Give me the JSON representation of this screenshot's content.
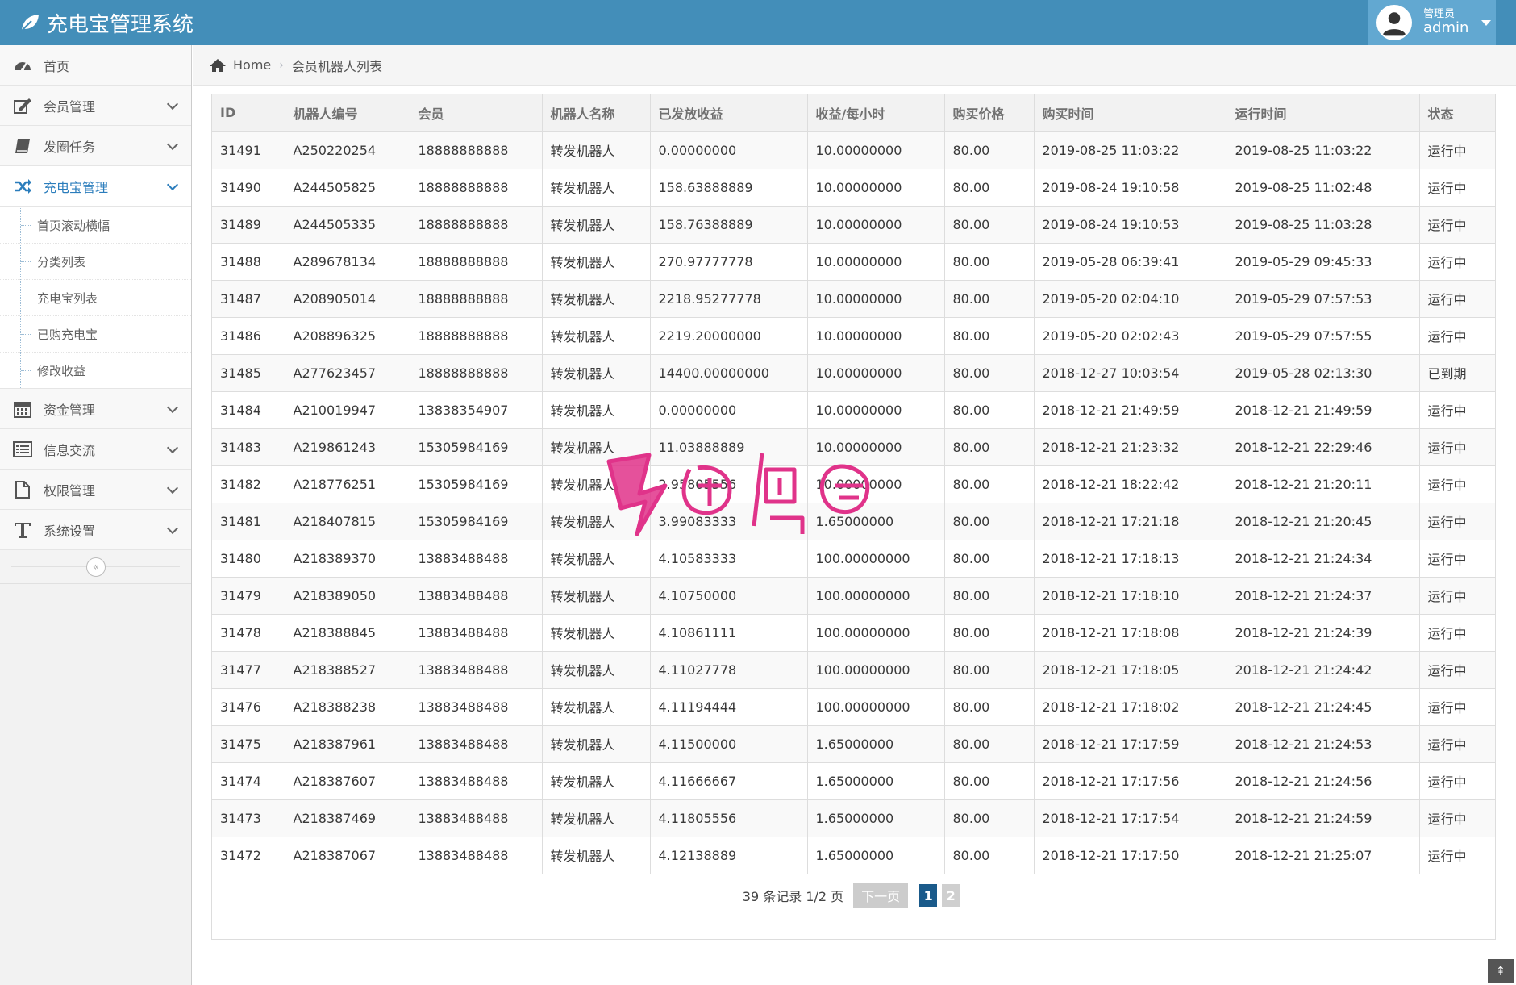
{
  "app": {
    "title": "充电宝管理系统"
  },
  "user": {
    "role": "管理员",
    "name": "admin"
  },
  "sidebar": {
    "items": [
      {
        "label": "首页",
        "icon": "dashboard-icon",
        "expandable": false
      },
      {
        "label": "会员管理",
        "icon": "edit-icon",
        "expandable": true
      },
      {
        "label": "发圈任务",
        "icon": "book-icon",
        "expandable": true
      },
      {
        "label": "充电宝管理",
        "icon": "shuffle-icon",
        "expandable": true,
        "active": true
      },
      {
        "label": "资金管理",
        "icon": "calendar-icon",
        "expandable": true
      },
      {
        "label": "信息交流",
        "icon": "list-alt-icon",
        "expandable": true
      },
      {
        "label": "权限管理",
        "icon": "file-icon",
        "expandable": true
      },
      {
        "label": "系统设置",
        "icon": "text-icon",
        "expandable": true
      }
    ],
    "submenu": [
      {
        "label": "首页滚动横幅"
      },
      {
        "label": "分类列表"
      },
      {
        "label": "充电宝列表"
      },
      {
        "label": "已购充电宝"
      },
      {
        "label": "修改收益"
      }
    ],
    "collapse_glyph": "«"
  },
  "breadcrumb": {
    "home": "Home",
    "current": "会员机器人列表"
  },
  "table": {
    "columns": [
      "ID",
      "机器人编号",
      "会员",
      "机器人名称",
      "已发放收益",
      "收益/每小时",
      "购买价格",
      "购买时间",
      "运行时间",
      "状态"
    ],
    "rows": [
      [
        "31491",
        "A250220254",
        "18888888888",
        "转发机器人",
        "0.00000000",
        "10.00000000",
        "80.00",
        "2019-08-25 11:03:22",
        "2019-08-25 11:03:22",
        "运行中"
      ],
      [
        "31490",
        "A244505825",
        "18888888888",
        "转发机器人",
        "158.63888889",
        "10.00000000",
        "80.00",
        "2019-08-24 19:10:58",
        "2019-08-25 11:02:48",
        "运行中"
      ],
      [
        "31489",
        "A244505335",
        "18888888888",
        "转发机器人",
        "158.76388889",
        "10.00000000",
        "80.00",
        "2019-08-24 19:10:53",
        "2019-08-25 11:03:28",
        "运行中"
      ],
      [
        "31488",
        "A289678134",
        "18888888888",
        "转发机器人",
        "270.97777778",
        "10.00000000",
        "80.00",
        "2019-05-28 06:39:41",
        "2019-05-29 09:45:33",
        "运行中"
      ],
      [
        "31487",
        "A208905014",
        "18888888888",
        "转发机器人",
        "2218.95277778",
        "10.00000000",
        "80.00",
        "2019-05-20 02:04:10",
        "2019-05-29 07:57:53",
        "运行中"
      ],
      [
        "31486",
        "A208896325",
        "18888888888",
        "转发机器人",
        "2219.20000000",
        "10.00000000",
        "80.00",
        "2019-05-20 02:02:43",
        "2019-05-29 07:57:55",
        "运行中"
      ],
      [
        "31485",
        "A277623457",
        "18888888888",
        "转发机器人",
        "14400.00000000",
        "10.00000000",
        "80.00",
        "2018-12-27 10:03:54",
        "2019-05-28 02:13:30",
        "已到期"
      ],
      [
        "31484",
        "A210019947",
        "13838354907",
        "转发机器人",
        "0.00000000",
        "10.00000000",
        "80.00",
        "2018-12-21 21:49:59",
        "2018-12-21 21:49:59",
        "运行中"
      ],
      [
        "31483",
        "A219861243",
        "15305984169",
        "转发机器人",
        "11.03888889",
        "10.00000000",
        "80.00",
        "2018-12-21 21:23:32",
        "2018-12-21 22:29:46",
        "运行中"
      ],
      [
        "31482",
        "A218776251",
        "15305984169",
        "转发机器人",
        "2.95805556",
        "10.00000000",
        "80.00",
        "2018-12-21 18:22:42",
        "2018-12-21 21:20:11",
        "运行中"
      ],
      [
        "31481",
        "A218407815",
        "15305984169",
        "转发机器人",
        "3.99083333",
        "1.65000000",
        "80.00",
        "2018-12-21 17:21:18",
        "2018-12-21 21:20:45",
        "运行中"
      ],
      [
        "31480",
        "A218389370",
        "13883488488",
        "转发机器人",
        "4.10583333",
        "100.00000000",
        "80.00",
        "2018-12-21 17:18:13",
        "2018-12-21 21:24:34",
        "运行中"
      ],
      [
        "31479",
        "A218389050",
        "13883488488",
        "转发机器人",
        "4.10750000",
        "100.00000000",
        "80.00",
        "2018-12-21 17:18:10",
        "2018-12-21 21:24:37",
        "运行中"
      ],
      [
        "31478",
        "A218388845",
        "13883488488",
        "转发机器人",
        "4.10861111",
        "100.00000000",
        "80.00",
        "2018-12-21 17:18:08",
        "2018-12-21 21:24:39",
        "运行中"
      ],
      [
        "31477",
        "A218388527",
        "13883488488",
        "转发机器人",
        "4.11027778",
        "100.00000000",
        "80.00",
        "2018-12-21 17:18:05",
        "2018-12-21 21:24:42",
        "运行中"
      ],
      [
        "31476",
        "A218388238",
        "13883488488",
        "转发机器人",
        "4.11194444",
        "100.00000000",
        "80.00",
        "2018-12-21 17:18:02",
        "2018-12-21 21:24:45",
        "运行中"
      ],
      [
        "31475",
        "A218387961",
        "13883488488",
        "转发机器人",
        "4.11500000",
        "1.65000000",
        "80.00",
        "2018-12-21 17:17:59",
        "2018-12-21 21:24:53",
        "运行中"
      ],
      [
        "31474",
        "A218387607",
        "13883488488",
        "转发机器人",
        "4.11666667",
        "1.65000000",
        "80.00",
        "2018-12-21 17:17:56",
        "2018-12-21 21:24:56",
        "运行中"
      ],
      [
        "31473",
        "A218387469",
        "13883488488",
        "转发机器人",
        "4.11805556",
        "1.65000000",
        "80.00",
        "2018-12-21 17:17:54",
        "2018-12-21 21:24:59",
        "运行中"
      ],
      [
        "31472",
        "A218387067",
        "13883488488",
        "转发机器人",
        "4.12138889",
        "1.65000000",
        "80.00",
        "2018-12-21 17:17:50",
        "2018-12-21 21:25:07",
        "运行中"
      ]
    ]
  },
  "pagination": {
    "summary": "39 条记录 1/2 页",
    "next_label": "下一页",
    "pages": [
      "1",
      "2"
    ],
    "current": "1"
  },
  "scroll_top_glyph": "⇞",
  "colors": {
    "navbar": "#438eb9",
    "accent": "#2b7dbc",
    "user_box": "#62a8d1",
    "watermark": "#e0338a"
  }
}
